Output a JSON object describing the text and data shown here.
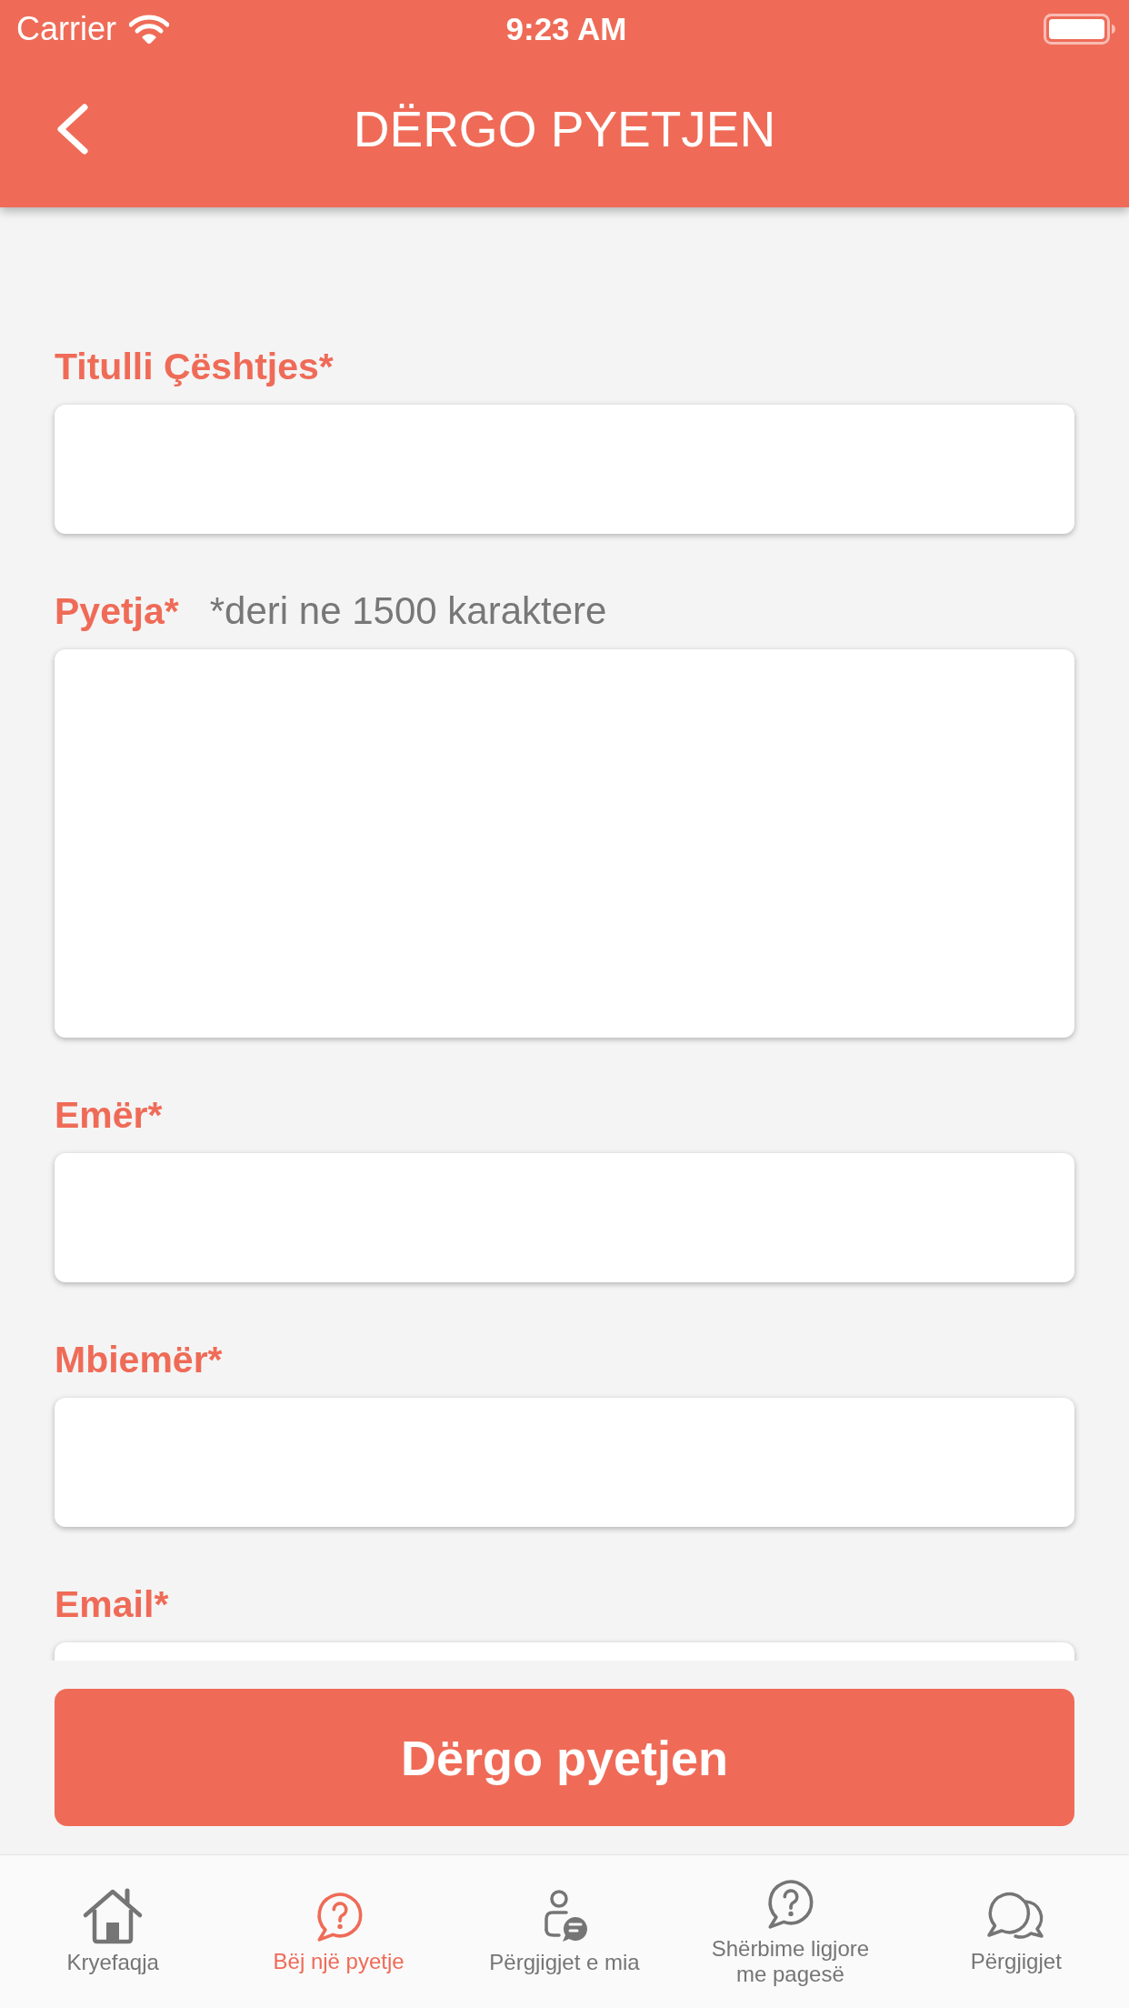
{
  "status_bar": {
    "carrier": "Carrier",
    "time": "9:23 AM"
  },
  "header": {
    "title": "DËRGO PYETJEN"
  },
  "form": {
    "fields": [
      {
        "kind": "input",
        "label": "Titulli Çështjes*"
      },
      {
        "kind": "textarea",
        "label": "Pyetja*",
        "hint": "*deri ne 1500 karaktere"
      },
      {
        "kind": "input",
        "label": "Emër*"
      },
      {
        "kind": "input",
        "label": "Mbiemër*"
      },
      {
        "kind": "input",
        "label": "Email*"
      }
    ]
  },
  "submit_button": {
    "label": "Dërgo pyetjen"
  },
  "tab_bar": {
    "items": [
      {
        "label": "Kryefaqja",
        "selected": false
      },
      {
        "label": "Bëj një pyetje",
        "selected": true
      },
      {
        "label": "Përgjigjet e mia",
        "selected": false
      },
      {
        "label": "Shërbime ligjore me pagesë",
        "selected": false
      },
      {
        "label": "Përgjigjet",
        "selected": false
      }
    ]
  }
}
